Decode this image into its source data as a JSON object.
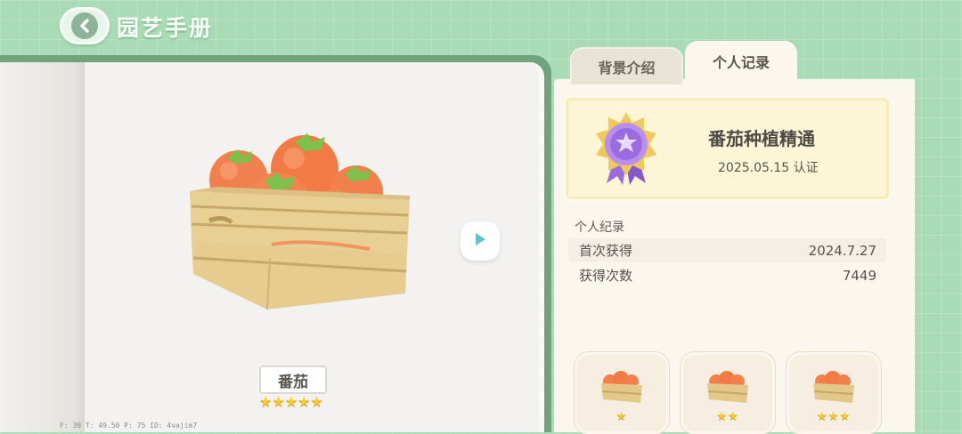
{
  "header": {
    "title": "园艺手册"
  },
  "tabs": [
    {
      "label": "背景介绍",
      "active": false
    },
    {
      "label": "个人记录",
      "active": true
    }
  ],
  "item": {
    "name": "番茄",
    "stars": "★★★★★"
  },
  "achievement": {
    "title": "番茄种植精通",
    "date": "2025.05.15 认证"
  },
  "records": {
    "header": "个人纪录",
    "rows": [
      {
        "label": "首次获得",
        "value": "2024.7.27"
      },
      {
        "label": "获得次数",
        "value": "7449"
      }
    ]
  },
  "variants": [
    {
      "stars": "★"
    },
    {
      "stars": "★★"
    },
    {
      "stars": "★★★"
    }
  ],
  "debug": "F: 30   T: 49.50   P: 75   ID: 4vajim7",
  "colors": {
    "background": "#a9dcb6",
    "panel": "#fbf6ee",
    "star": "#f7c92e",
    "medal": "#9b6be0"
  },
  "icons": {
    "back": "chevron-left-icon",
    "play": "play-icon"
  }
}
